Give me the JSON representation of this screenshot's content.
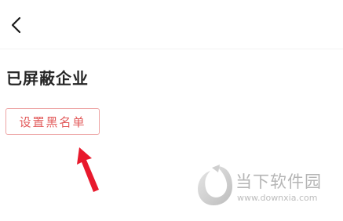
{
  "header": {
    "back_icon": "chevron-left-icon"
  },
  "main": {
    "section_title": "已屏蔽企业",
    "set_blacklist_label": "设置黑名单"
  },
  "annotation": {
    "arrow_icon": "red-arrow-icon",
    "arrow_color": "#e8192c"
  },
  "watermark": {
    "title": "当下软件园",
    "url": "www.downxia.com"
  },
  "colors": {
    "button_border": "#eda4a4",
    "button_text": "#e25a5a",
    "title_text": "#262626",
    "watermark_gray": "#b5b5b5"
  }
}
